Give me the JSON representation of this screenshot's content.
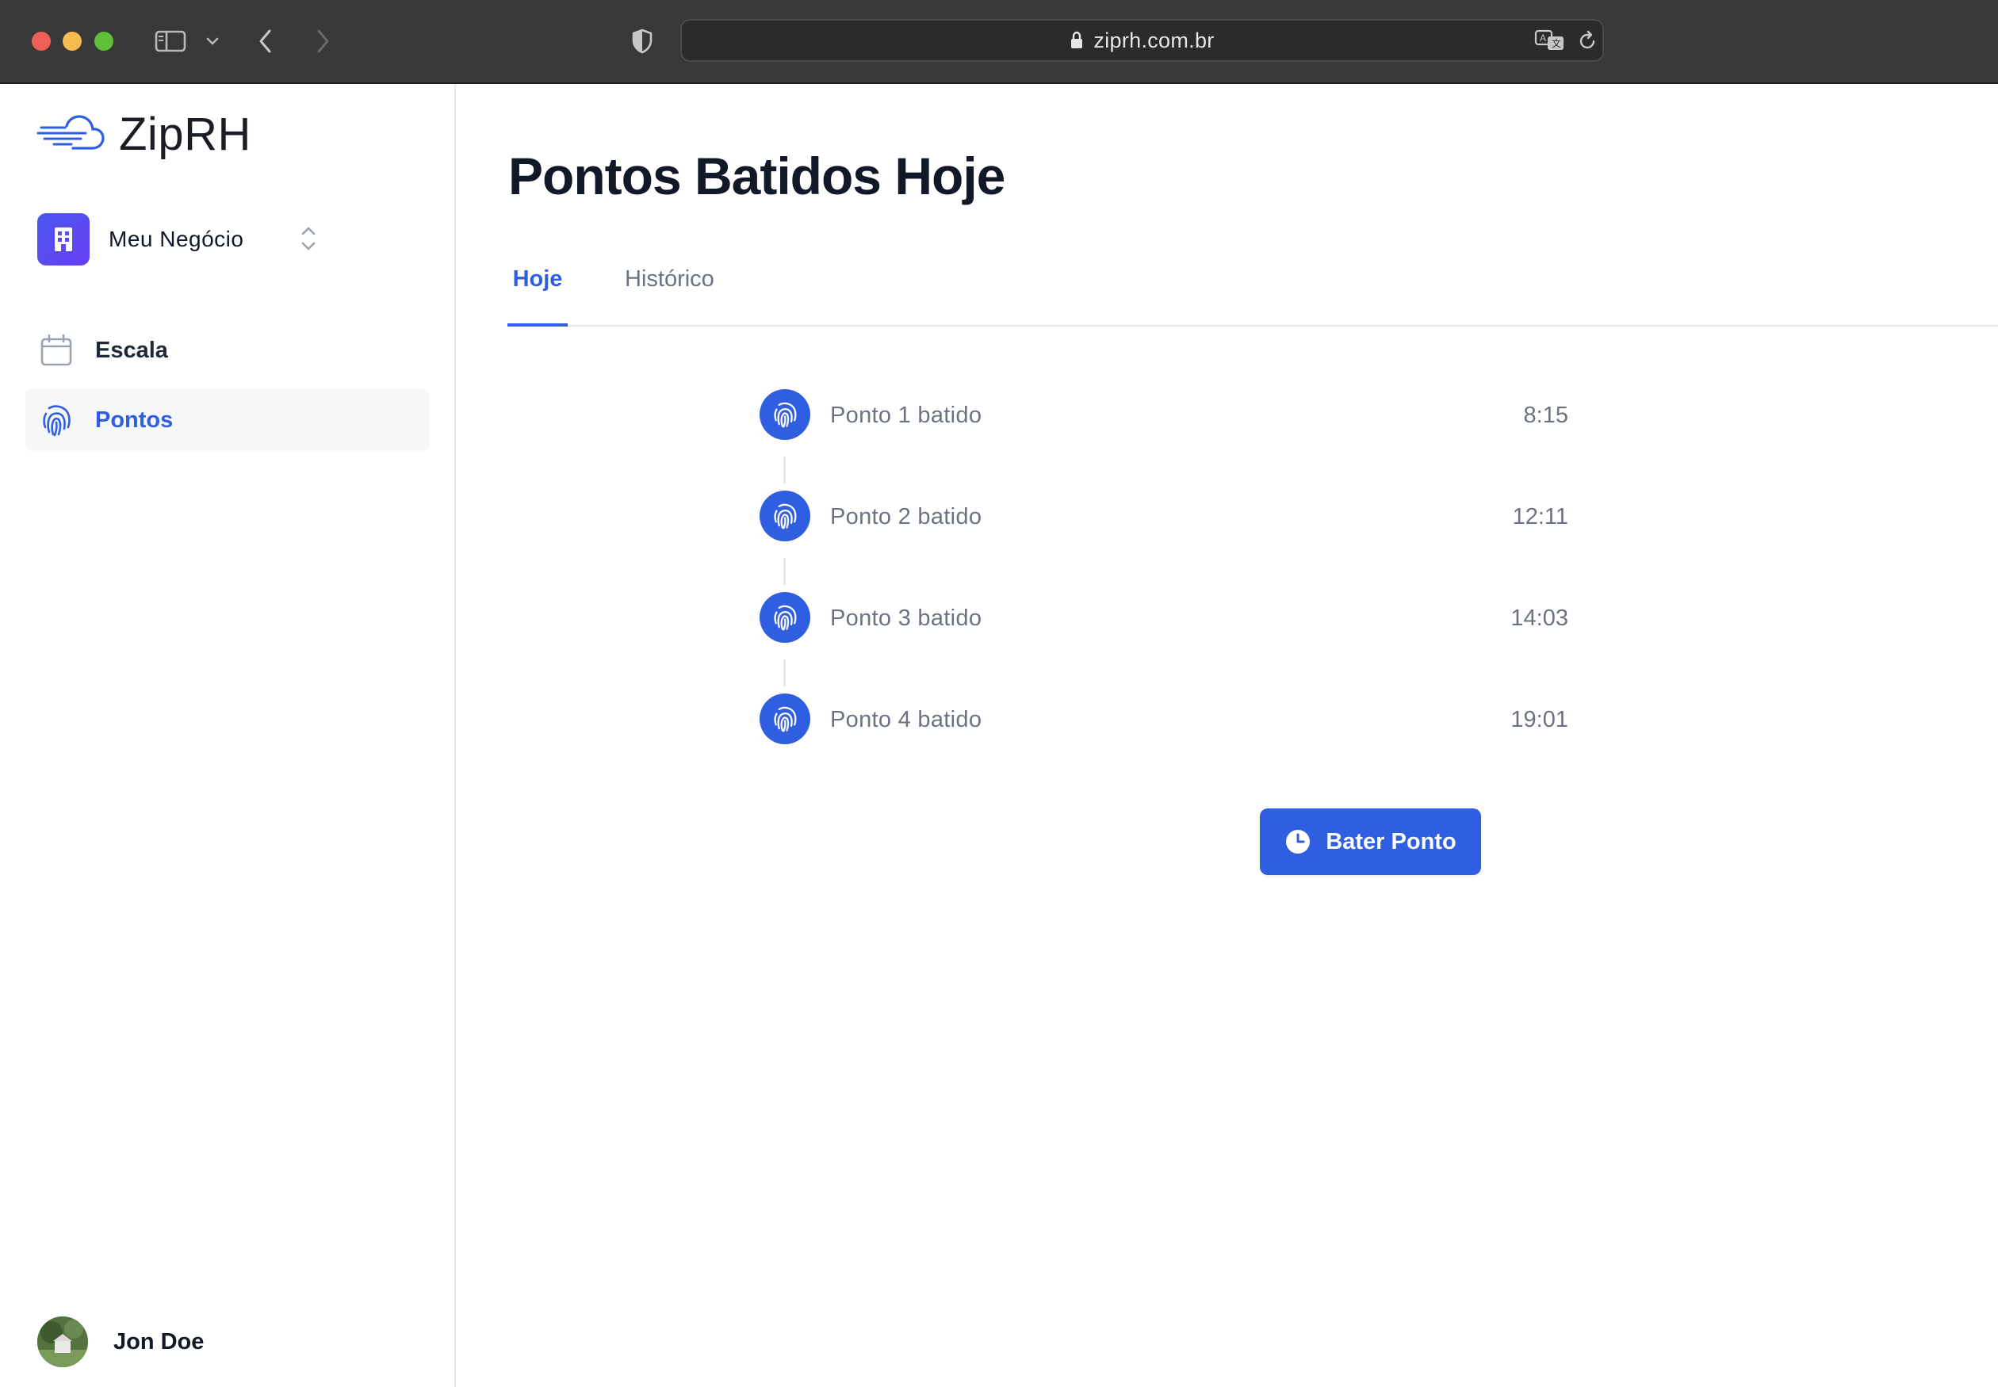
{
  "browser": {
    "url": "ziprh.com.br"
  },
  "sidebar": {
    "logo_text": "ZipRH",
    "business": {
      "name": "Meu Negócio",
      "icon": "building-icon"
    },
    "items": [
      {
        "label": "Escala",
        "icon": "calendar-icon",
        "active": false
      },
      {
        "label": "Pontos",
        "icon": "fingerprint-icon",
        "active": true
      }
    ],
    "user": {
      "name": "Jon Doe"
    }
  },
  "main": {
    "title": "Pontos Batidos Hoje",
    "tabs": [
      {
        "label": "Hoje",
        "active": true
      },
      {
        "label": "Histórico",
        "active": false
      }
    ],
    "entries": [
      {
        "label": "Ponto 1 batido",
        "time": "8:15"
      },
      {
        "label": "Ponto 2 batido",
        "time": "12:11"
      },
      {
        "label": "Ponto 3 batido",
        "time": "14:03"
      },
      {
        "label": "Ponto 4 batido",
        "time": "19:01"
      }
    ],
    "action_button": {
      "label": "Bater Ponto",
      "icon": "clock-icon"
    }
  },
  "colors": {
    "accent": "#2f5fe0",
    "chrome": "#383838",
    "text_dark": "#111827",
    "text_muted": "#6b7280"
  }
}
